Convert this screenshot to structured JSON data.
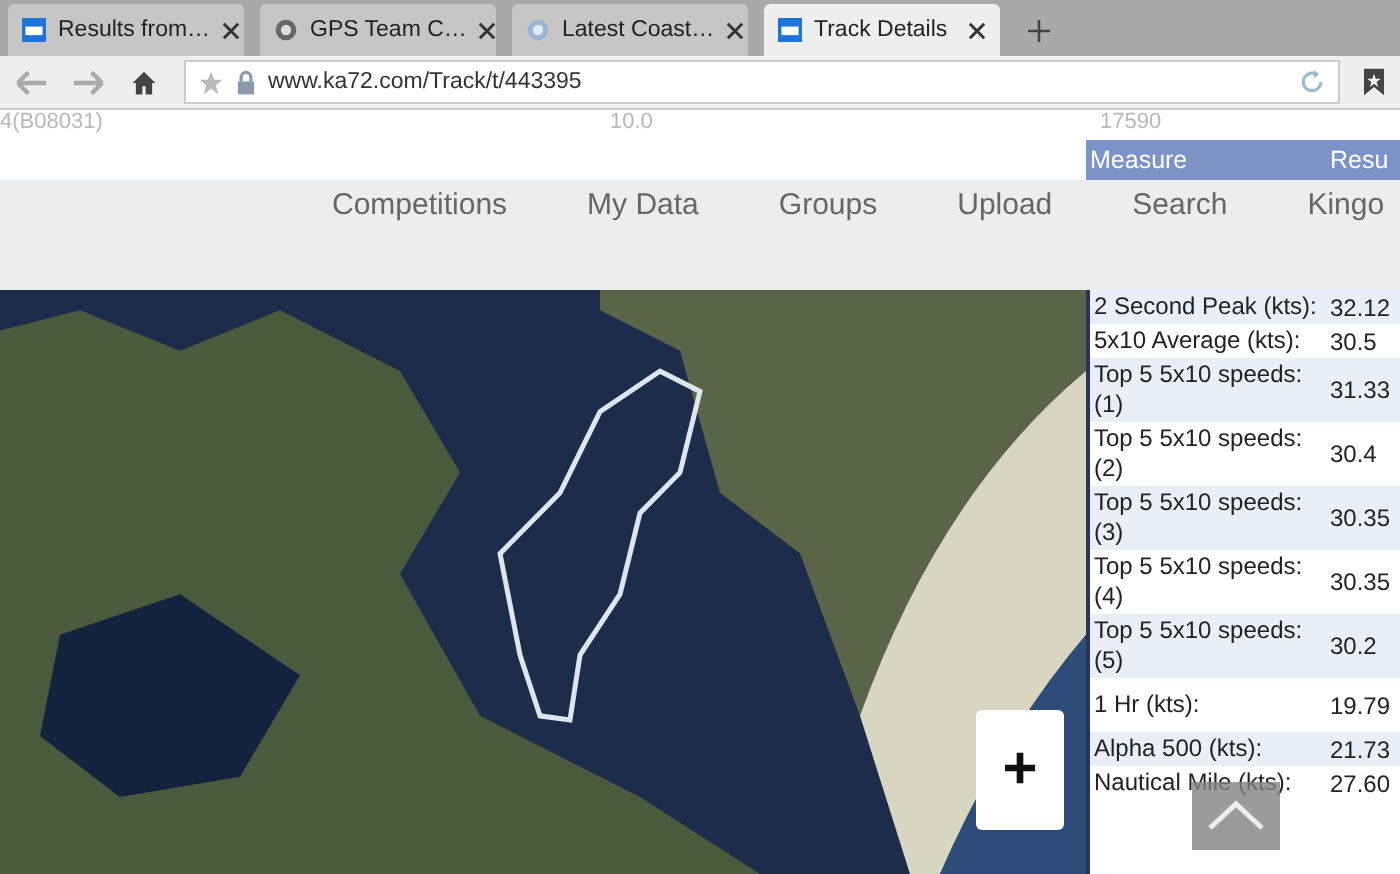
{
  "browser": {
    "tabs": [
      {
        "title": "Results from…",
        "selected": false
      },
      {
        "title": "GPS Team C…",
        "selected": false
      },
      {
        "title": "Latest Coast…",
        "selected": false
      },
      {
        "title": "Track Details",
        "selected": true
      }
    ],
    "url": "www.ka72.com/Track/t/443395"
  },
  "top_row": [
    "4(B08031)",
    "10.0",
    "17590"
  ],
  "nav": [
    "Competitions",
    "My Data",
    "Groups",
    "Upload",
    "Search",
    "Kingo"
  ],
  "table": {
    "columns": [
      "Measure",
      "Resu"
    ],
    "rows": [
      {
        "measure": "2 Second Peak (kts):",
        "result": "32.12"
      },
      {
        "measure": "5x10 Average (kts):",
        "result": "30.5"
      },
      {
        "measure": "Top 5 5x10 speeds: (1)",
        "result": "31.33"
      },
      {
        "measure": "Top 5 5x10 speeds: (2)",
        "result": "30.4"
      },
      {
        "measure": "Top 5 5x10 speeds: (3)",
        "result": "30.35"
      },
      {
        "measure": "Top 5 5x10 speeds: (4)",
        "result": "30.35"
      },
      {
        "measure": "Top 5 5x10 speeds: (5)",
        "result": "30.2"
      },
      {
        "measure": "1 Hr (kts):",
        "result": "19.79"
      },
      {
        "measure": "Alpha 500 (kts):",
        "result": "21.73"
      },
      {
        "measure": "Nautical Mile (kts):",
        "result": "27.60"
      }
    ]
  },
  "map": {
    "zoom_in": "+"
  }
}
